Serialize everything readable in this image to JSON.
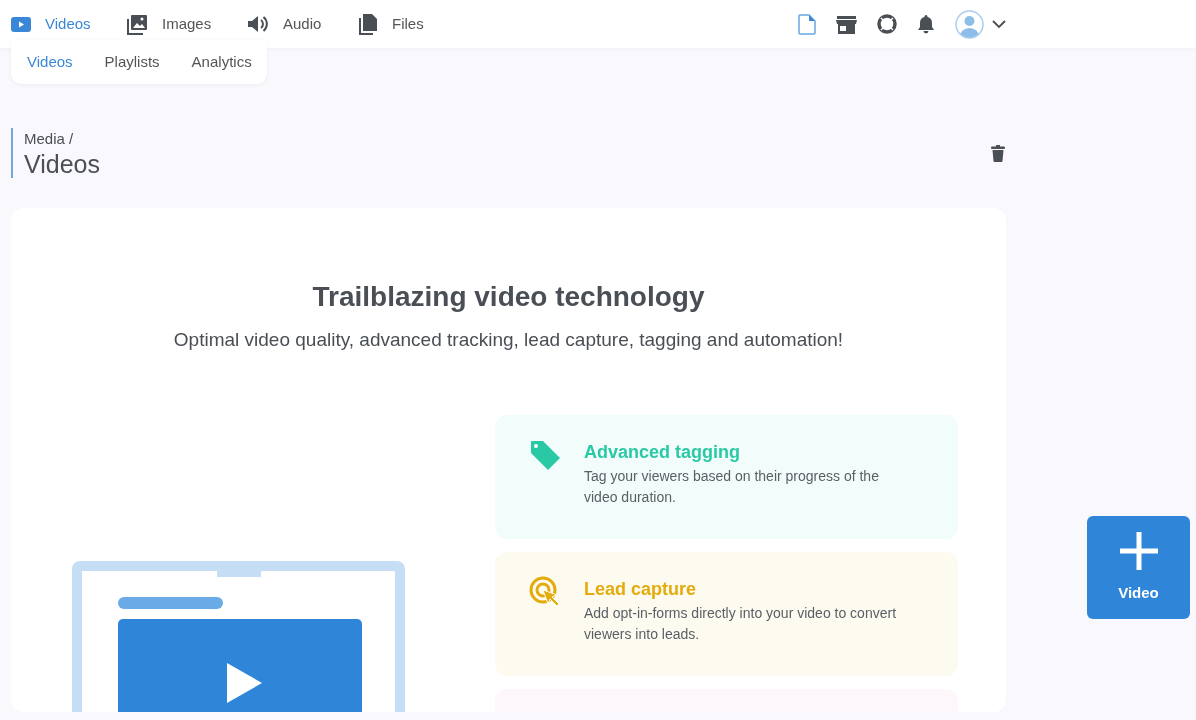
{
  "top_nav": {
    "items": [
      {
        "label": "Videos",
        "kind": "video",
        "selected": true
      },
      {
        "label": "Images",
        "kind": "images",
        "selected": false
      },
      {
        "label": "Audio",
        "kind": "audio",
        "selected": false
      },
      {
        "label": "Files",
        "kind": "files",
        "selected": false
      }
    ]
  },
  "sub_tabs": [
    {
      "label": "Videos",
      "selected": true
    },
    {
      "label": "Playlists",
      "selected": false
    },
    {
      "label": "Analytics",
      "selected": false
    }
  ],
  "breadcrumb": {
    "parent": "Media /",
    "title": "Videos"
  },
  "hero": {
    "title": "Trailblazing video technology",
    "subtitle": "Optimal video quality, advanced tracking, lead capture, tagging and automation!"
  },
  "features": [
    {
      "kind": "tag",
      "color": "#2ac9a6",
      "title": "Advanced tagging",
      "text": "Tag your viewers based on their progress of the video duration."
    },
    {
      "kind": "target",
      "color": "#e3ab0b",
      "title": "Lead capture",
      "text": "Add opt-in-forms directly into your video to convert viewers into leads."
    },
    {
      "kind": "empty",
      "color": "#fdf6fb"
    }
  ],
  "add_button": {
    "label": "Video"
  }
}
